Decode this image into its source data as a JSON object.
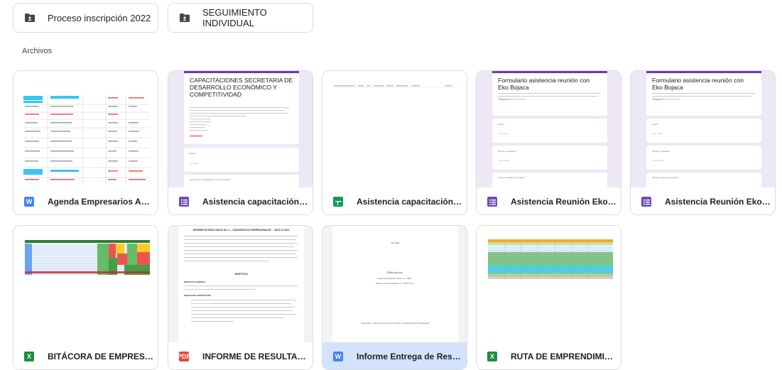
{
  "folders": [
    {
      "name": "Proceso inscripción 2022",
      "icon": "shared-folder-icon"
    },
    {
      "name": "SEGUIMIENTO INDIVIDUAL",
      "icon": "shared-folder-icon"
    }
  ],
  "section_title": "Archivos",
  "files": [
    {
      "name": "Agenda Empresarios Actuali...",
      "type": "word"
    },
    {
      "name": "Asistencia capacitación cost...",
      "type": "forms"
    },
    {
      "name": "Asistencia capacitación cost...",
      "type": "sheets"
    },
    {
      "name": "Asistencia Reunión Eko Boja...",
      "type": "forms"
    },
    {
      "name": "Asistencia Reunión Eko Boja...",
      "type": "forms"
    },
    {
      "name": "BITÁCORA DE EMPRESARIO...",
      "type": "excel"
    },
    {
      "name": "INFORME DE RESULTADOS N...",
      "type": "pdf"
    },
    {
      "name": "Informe Entrega de Resultad...",
      "type": "word",
      "selected": true
    },
    {
      "name": "RUTA DE EMPRENDIMIENTO...",
      "type": "excel"
    }
  ],
  "icon_letters": {
    "word": "W",
    "excel": "X",
    "pdf": "PDF"
  },
  "thumbs": {
    "form1": {
      "title": "CAPACITACIONES SECRETARIA DE DESARROLLO ECONÓMICO Y COMPETITIVIDAD",
      "email_label": "Email *",
      "email_placeholder": "Tu email",
      "question": "Nombre de la capacitación a la que asistió *"
    },
    "form2": {
      "title": "Formulario asistencia reunión con Eko Bojaca",
      "required": "*Required",
      "email_label": "Email *",
      "email_placeholder": "Your email",
      "name_label": "Nombre y Apellido *",
      "name_placeholder": "Your answer",
      "phone_label": "Número celular de contacto *"
    },
    "report": {
      "header": "INFORME DE RESULTADOS NO. 1 – “DIAGNÓSTICOS EMPRESARIALES” – RUTA 01 2022",
      "heading": "OBJETIVOS",
      "sub1": "OBJETIVO GENERAL",
      "sub2": "OBJETIVOS ESPECÍFICOS"
    },
    "delivery": {
      "cover_title": "Informe",
      "prepared": "Elaborado por:",
      "author1": "Jorge Yesid Herrera Currea C.C 1069 ...",
      "author2": "Diana Carolina González CC 1.069.735.7...",
      "footer": "Presentado a: Oficina de desarrollo económico y competitividad de Funagasugá"
    }
  }
}
